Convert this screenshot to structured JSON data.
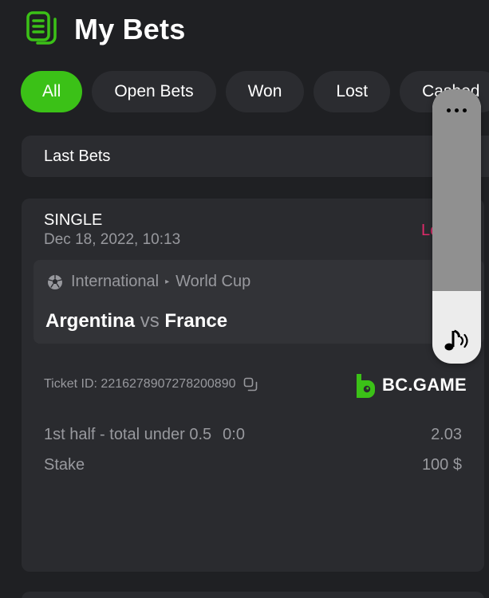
{
  "header": {
    "title": "My Bets",
    "icon": "document-list-icon"
  },
  "tabs": [
    {
      "label": "All",
      "active": true
    },
    {
      "label": "Open Bets",
      "active": false
    },
    {
      "label": "Won",
      "active": false
    },
    {
      "label": "Lost",
      "active": false
    },
    {
      "label": "Cashed",
      "active": false
    }
  ],
  "last_bets": {
    "label": "Last Bets"
  },
  "bet": {
    "type": "SINGLE",
    "date": "Dec 18, 2022, 10:13",
    "status": "Lost",
    "league_category": "International",
    "league_name": "World Cup",
    "home_team": "Argentina",
    "vs": "vs",
    "away_team": "France",
    "ticket_id": "Ticket ID: 2216278907278200890",
    "brand": "BC.GAME",
    "selection": "1st half - total under 0.5",
    "score": "0:0",
    "odds": "2.03",
    "stake_label": "Stake",
    "stake_value": "100 $"
  },
  "colors": {
    "background": "#1f2023",
    "accent": "#3bc117",
    "status_lost": "#e02a6a",
    "muted_text": "#98999e"
  }
}
